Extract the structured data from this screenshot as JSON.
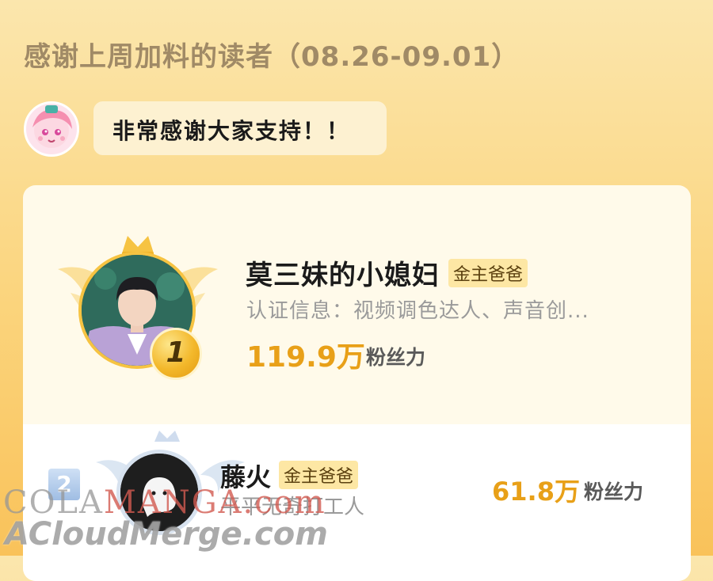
{
  "header": {
    "title": "感谢上周加料的读者（08.26-09.01）"
  },
  "message": {
    "text": "非常感谢大家支持！！",
    "avatar_icon": "mascot-avatar-icon"
  },
  "leaderboard": [
    {
      "rank": "1",
      "name": "莫三妹的小媳妇",
      "tag": "金主爸爸",
      "cert": "认证信息：视频调色达人、声音创...",
      "fans_value": "119.9万",
      "fans_label": "粉丝力",
      "rank_icon": "gold-crown-wings-icon"
    },
    {
      "rank": "2",
      "name": "藤火",
      "tag": "金主爸爸",
      "cert": "平平无奇打工人",
      "fans_value": "61.8万",
      "fans_label": "粉丝力",
      "rank_icon": "silver-wings-icon"
    }
  ],
  "watermark": {
    "line1_a": "COLA",
    "line1_b": "MANGA",
    "line1_c": ".com",
    "line2": "ACloudMerge.com"
  },
  "colors": {
    "accent": "#e8a018",
    "tag_bg": "#fde7a4",
    "gold": "#f3b82b",
    "silver": "#9fbde3"
  }
}
